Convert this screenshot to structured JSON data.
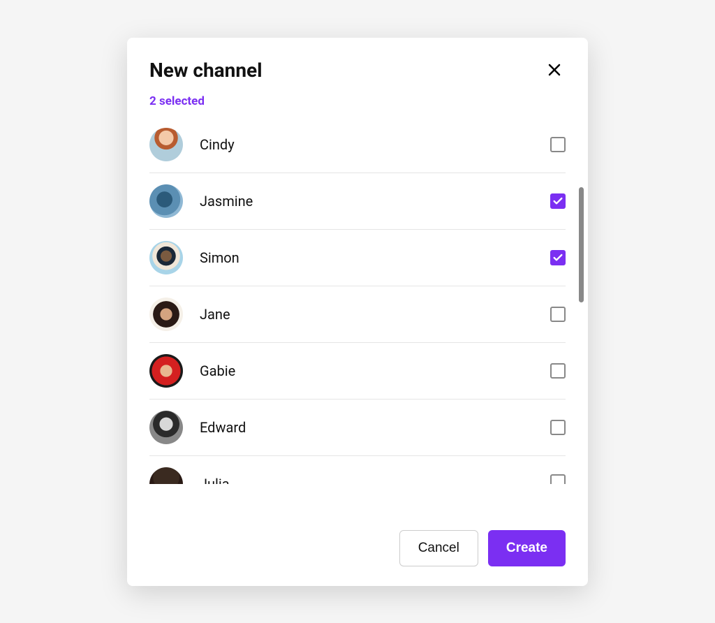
{
  "modal": {
    "title": "New channel",
    "selected_text": "2 selected"
  },
  "users": [
    {
      "name": "Cindy",
      "avatar_class": "cindy",
      "selected": false
    },
    {
      "name": "Jasmine",
      "avatar_class": "jasmine",
      "selected": true
    },
    {
      "name": "Simon",
      "avatar_class": "simon",
      "selected": true
    },
    {
      "name": "Jane",
      "avatar_class": "jane",
      "selected": false
    },
    {
      "name": "Gabie",
      "avatar_class": "gabie",
      "selected": false
    },
    {
      "name": "Edward",
      "avatar_class": "edward",
      "selected": false
    },
    {
      "name": "Julia",
      "avatar_class": "julia",
      "selected": false
    }
  ],
  "footer": {
    "cancel_label": "Cancel",
    "create_label": "Create"
  },
  "colors": {
    "accent": "#7b2ff2"
  }
}
